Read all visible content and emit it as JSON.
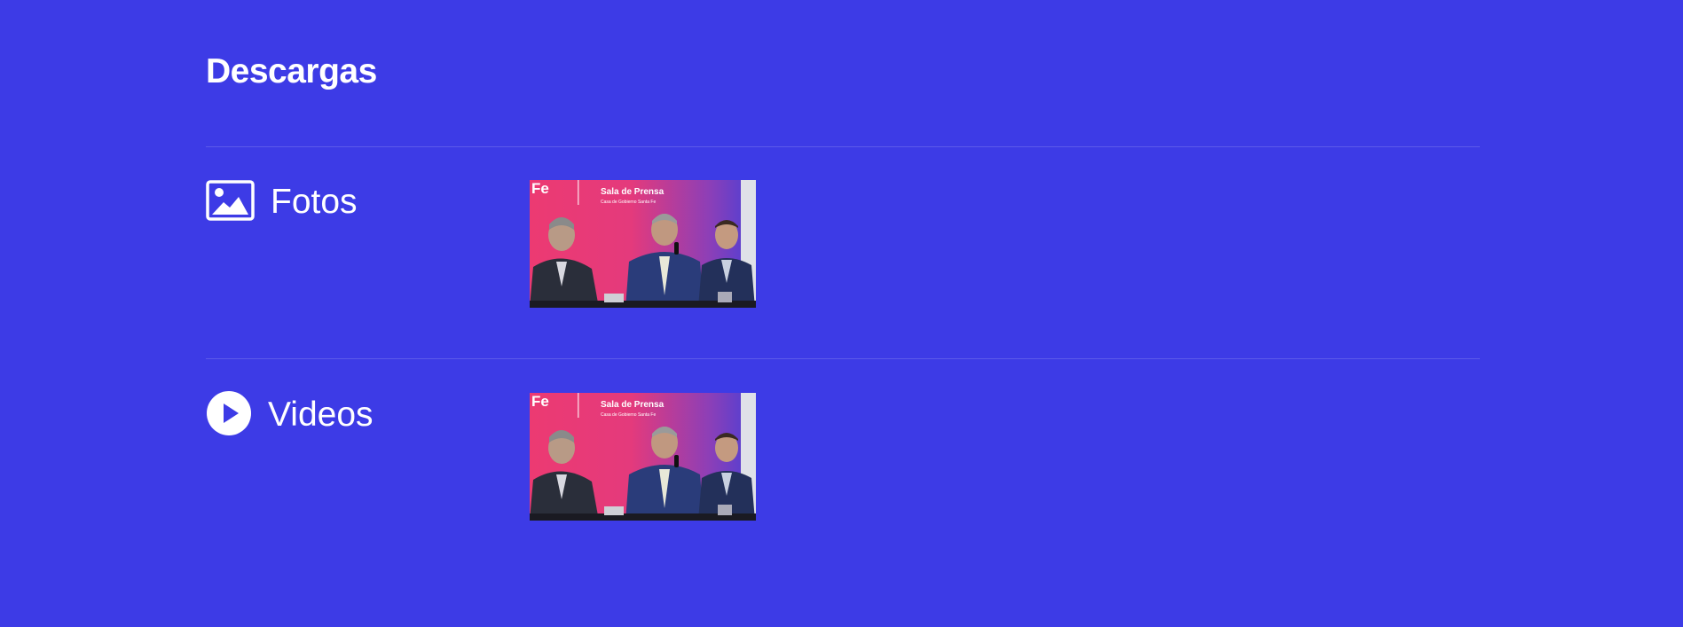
{
  "section": {
    "title": "Descargas"
  },
  "rows": [
    {
      "label": "Fotos",
      "icon": "image-icon",
      "thumbnail": {
        "alt": "Sala de Prensa",
        "banner_title": "Sala de Prensa",
        "banner_subtitle": "Casa de Gobierno Santa Fe",
        "logo_text": "Fe"
      }
    },
    {
      "label": "Videos",
      "icon": "play-circle-icon",
      "thumbnail": {
        "alt": "Sala de Prensa",
        "banner_title": "Sala de Prensa",
        "banner_subtitle": "Casa de Gobierno Santa Fe",
        "logo_text": "Fe"
      }
    }
  ],
  "colors": {
    "background": "#3d3be6",
    "text": "#ffffff",
    "banner_pink": "#e8336e",
    "banner_purple": "#5a44d8"
  }
}
